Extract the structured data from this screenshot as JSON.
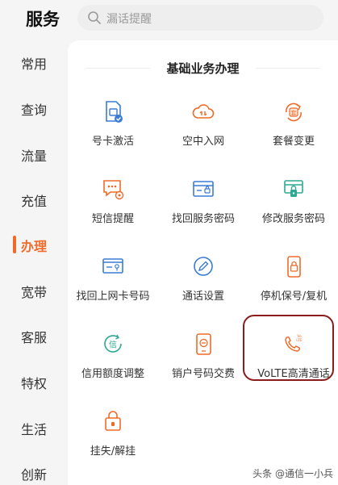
{
  "sidebar": {
    "title": "服务",
    "items": [
      {
        "label": "常用"
      },
      {
        "label": "查询"
      },
      {
        "label": "流量"
      },
      {
        "label": "充值"
      },
      {
        "label": "办理",
        "active": true
      },
      {
        "label": "宽带"
      },
      {
        "label": "客服"
      },
      {
        "label": "特权"
      },
      {
        "label": "生活"
      },
      {
        "label": "创新"
      }
    ]
  },
  "search": {
    "placeholder": "漏话提醒",
    "icon": "search-icon"
  },
  "section": {
    "title": "基础业务办理",
    "tiles": [
      {
        "label": "号卡激活",
        "icon": "sim-activate-icon"
      },
      {
        "label": "空中入网",
        "icon": "cloud-icon"
      },
      {
        "label": "套餐变更",
        "icon": "plan-change-icon"
      },
      {
        "label": "短信提醒",
        "icon": "sms-settings-icon"
      },
      {
        "label": "找回服务密码",
        "icon": "password-card-icon"
      },
      {
        "label": "修改服务密码",
        "icon": "lock-card-icon"
      },
      {
        "label": "找回上网卡号码",
        "icon": "data-card-icon"
      },
      {
        "label": "通话设置",
        "icon": "pencil-icon"
      },
      {
        "label": "停机保号/复机",
        "icon": "phone-lock-icon"
      },
      {
        "label": "信用额度调整",
        "icon": "credit-icon"
      },
      {
        "label": "销户号码交费",
        "icon": "phone-cancel-icon"
      },
      {
        "label": "VoLTE高清通话",
        "icon": "volte-icon"
      },
      {
        "label": "挂失/解挂",
        "icon": "lock-icon"
      }
    ]
  },
  "watermark": "头条 @通信一小兵",
  "colors": {
    "accent": "#f06a29",
    "blue": "#3a7bd5",
    "highlight": "#8b1c1c"
  }
}
